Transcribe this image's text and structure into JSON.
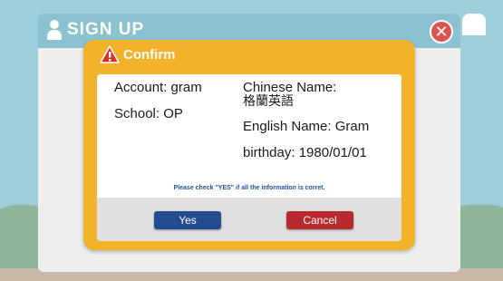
{
  "signup": {
    "title": "SIGN UP",
    "close_label": "✕"
  },
  "dialog": {
    "title": "Confirm",
    "account": "Account: gram",
    "school": "School: OP",
    "chinese_name_label": "Chinese Name:",
    "chinese_name_value": "格蘭英語",
    "english_name": "English Name: Gram",
    "birthday": "birthday: 1980/01/01",
    "note": "Please check \"YES\" if all the information is corret.",
    "yes_label": "Yes",
    "cancel_label": "Cancel"
  },
  "colors": {
    "dialog_frame": "#f2b22a",
    "yes": "#244c8f",
    "cancel": "#b82a2d",
    "header": "#8cc1cf"
  }
}
